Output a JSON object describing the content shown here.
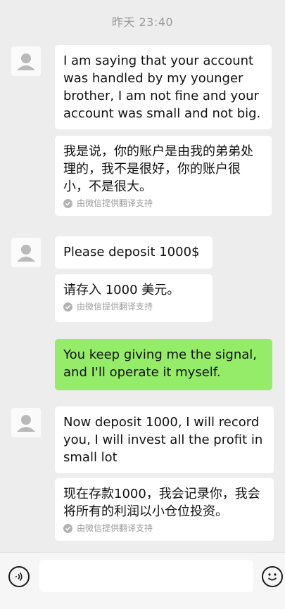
{
  "chat": {
    "timestamp": "昨天 23:40",
    "messages": [
      {
        "sender": "contact",
        "text": "I am saying that your account was handled by my younger brother, I am not fine and your account was small and not big.",
        "translation": "我是说，你的账户是由我的弟弟处理的，我不是很好，你的账户很小，不是很大。",
        "translation_note": "由微信提供翻译支持"
      },
      {
        "sender": "contact",
        "text": "Please deposit 1000$",
        "translation": "请存入 1000 美元。",
        "translation_note": "由微信提供翻译支持"
      },
      {
        "sender": "me",
        "text": "You keep giving me the signal, and I'll operate it myself."
      },
      {
        "sender": "contact",
        "text": "Now deposit 1000, I will record you, I will invest all the profit in small lot",
        "translation": "现在存款1000，我会记录你，我会将所有的利润以小仓位投资。",
        "translation_note": "由微信提供翻译支持"
      }
    ]
  },
  "input_bar": {
    "placeholder": "",
    "voice_icon": "voice-icon",
    "emoji_icon": "emoji-icon"
  },
  "colors": {
    "background": "#ededed",
    "bubble_incoming": "#ffffff",
    "bubble_outgoing": "#95ec69"
  }
}
